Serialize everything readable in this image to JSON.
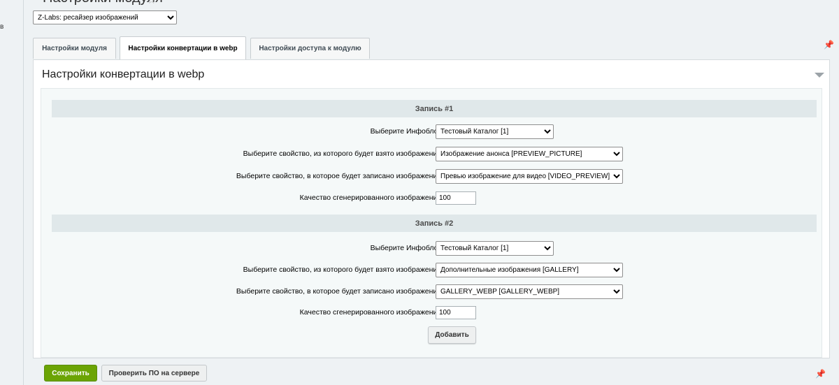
{
  "left_strip": {
    "label": "в"
  },
  "page": {
    "title": "Настройки модуля",
    "star_icon": "star-icon"
  },
  "module_select": {
    "value": "Z-Labs: ресайзер изображений"
  },
  "tabs": [
    {
      "label": "Настройки модуля"
    },
    {
      "label": "Настройки конвертации в webp"
    },
    {
      "label": "Настройки доступа к модулю"
    }
  ],
  "panel": {
    "title": "Настройки конвертации в webp"
  },
  "records": [
    {
      "header": "Запись #1",
      "iblock_label": "Выберите Инфоблок:",
      "iblock_value": "Тестовый Каталог [1]",
      "source_label": "Выберите свойство, из которого будет взято изображение:",
      "source_value": "Изображение анонса [PREVIEW_PICTURE]",
      "target_label": "Выберите свойство, в которое будет записано изображение:",
      "target_value": "Превью изображение для видео [VIDEO_PREVIEW]",
      "quality_label": "Качество сгенерированного изображения:",
      "quality_value": "100"
    },
    {
      "header": "Запись #2",
      "iblock_label": "Выберите Инфоблок:",
      "iblock_value": "Тестовый Каталог [1]",
      "source_label": "Выберите свойство, из которого будет взято изображение:",
      "source_value": "Дополнительные изображения [GALLERY]",
      "target_label": "Выберите свойство, в которое будет записано изображение:",
      "target_value": "GALLERY_WEBP [GALLERY_WEBP]",
      "quality_label": "Качество сгенерированного изображения:",
      "quality_value": "100"
    }
  ],
  "buttons": {
    "add": "Добавить",
    "save": "Сохранить",
    "check": "Проверить ПО на сервере"
  },
  "colors": {
    "save_bg": "#6ba404",
    "header_bg": "#e0e8ea"
  }
}
